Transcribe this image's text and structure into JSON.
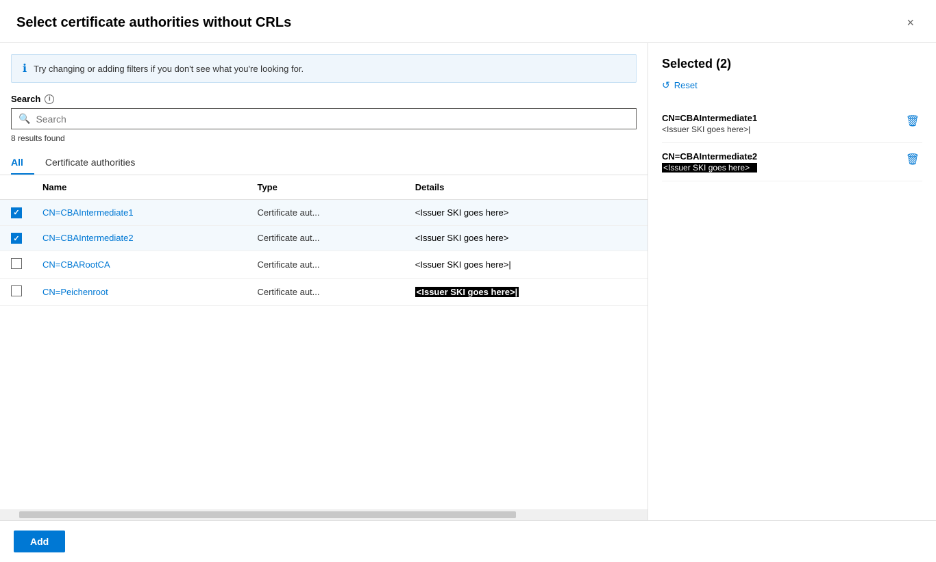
{
  "dialog": {
    "title": "Select certificate authorities without CRLs",
    "close_label": "×"
  },
  "info_banner": {
    "text": "Try changing or adding filters if you don't see what you're looking for."
  },
  "search": {
    "label": "Search",
    "placeholder": "Search",
    "results_count": "8 results found"
  },
  "tabs": [
    {
      "id": "all",
      "label": "All",
      "active": true
    },
    {
      "id": "certificate-authorities",
      "label": "Certificate authorities",
      "active": false
    }
  ],
  "table": {
    "columns": [
      "",
      "Name",
      "Type",
      "Details"
    ],
    "rows": [
      {
        "id": "row1",
        "checked": true,
        "name": "CN=CBAIntermediate1",
        "type": "Certificate aut...",
        "details": "<Issuer SKI goes here>",
        "details_highlighted": false,
        "selected": true
      },
      {
        "id": "row2",
        "checked": true,
        "name": "CN=CBAIntermediate2",
        "type": "Certificate aut...",
        "details": "<Issuer SKI goes here>",
        "details_highlighted": false,
        "selected": true
      },
      {
        "id": "row3",
        "checked": false,
        "name": "CN=CBARootCA",
        "type": "Certificate aut...",
        "details": "<Issuer SKI goes here>|",
        "details_highlighted": false,
        "selected": false
      },
      {
        "id": "row4",
        "checked": false,
        "name": "CN=Peichenroot",
        "type": "Certificate aut...",
        "details": "<Issuer SKI goes here>|",
        "details_highlighted": true,
        "selected": false
      }
    ]
  },
  "right_panel": {
    "selected_label": "Selected (2)",
    "reset_label": "Reset",
    "items": [
      {
        "id": "sel1",
        "name": "CN=CBAIntermediate1",
        "sub": "<Issuer SKI goes here>|",
        "sub_highlighted": false
      },
      {
        "id": "sel2",
        "name": "CN=CBAIntermediate2",
        "sub": "<Issuer SKI goes here>",
        "sub_highlighted": true
      }
    ]
  },
  "footer": {
    "add_label": "Add"
  }
}
